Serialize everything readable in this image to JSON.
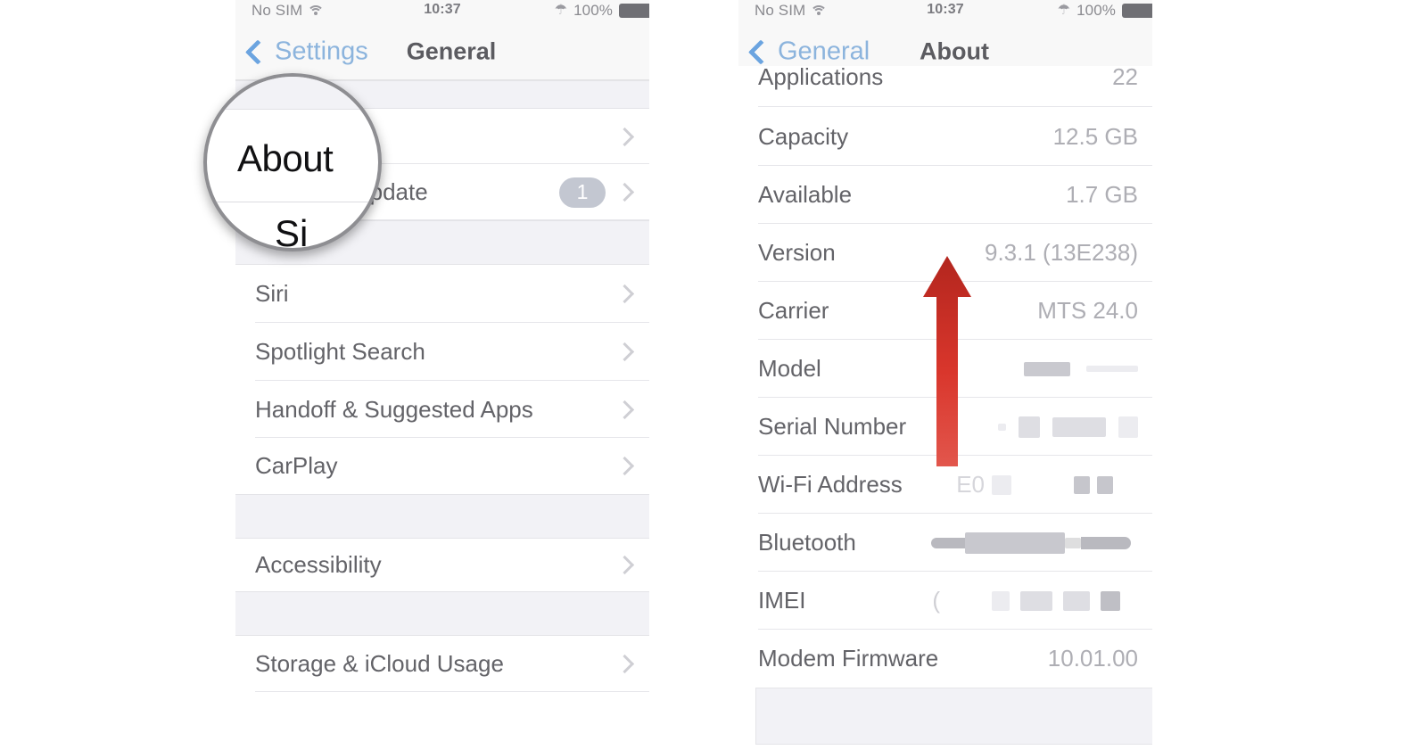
{
  "status_bar": {
    "carrier": "No SIM",
    "wifi_icon": "wifi-icon",
    "time": "10:37",
    "bluetooth_icon": "bluetooth-icon",
    "battery_percent": "100%",
    "battery_icon": "battery-full-icon"
  },
  "left_phone": {
    "nav": {
      "back_label": "Settings",
      "back_icon": "chevron-left-icon",
      "title": "General"
    },
    "rows": [
      {
        "label": "About",
        "value": "",
        "chevron": true,
        "badge": ""
      },
      {
        "label": "Software Update",
        "value": "",
        "chevron": true,
        "badge": "1"
      },
      {
        "label": "Siri",
        "value": "",
        "chevron": true,
        "badge": ""
      },
      {
        "label": "Spotlight Search",
        "value": "",
        "chevron": true,
        "badge": ""
      },
      {
        "label": "Handoff & Suggested Apps",
        "value": "",
        "chevron": true,
        "badge": ""
      },
      {
        "label": "CarPlay",
        "value": "",
        "chevron": true,
        "badge": ""
      },
      {
        "label": "Accessibility",
        "value": "",
        "chevron": true,
        "badge": ""
      },
      {
        "label": "Storage & iCloud Usage",
        "value": "",
        "chevron": true,
        "badge": ""
      }
    ]
  },
  "magnifier": {
    "zoomed_label": "About",
    "partial_label": "Si",
    "ring_color": "#8e8e92"
  },
  "right_phone": {
    "nav": {
      "back_label": "General",
      "back_icon": "chevron-left-icon",
      "title": "About"
    },
    "rows": [
      {
        "label": "Applications",
        "value": "22",
        "redacted": false
      },
      {
        "label": "Capacity",
        "value": "12.5 GB",
        "redacted": false
      },
      {
        "label": "Available",
        "value": "1.7 GB",
        "redacted": false
      },
      {
        "label": "Version",
        "value": "9.3.1 (13E238)",
        "redacted": false
      },
      {
        "label": "Carrier",
        "value": "MTS 24.0",
        "redacted": false
      },
      {
        "label": "Model",
        "value": "",
        "redacted": true
      },
      {
        "label": "Serial Number",
        "value": "",
        "redacted": true
      },
      {
        "label": "Wi-Fi Address",
        "value": "E0",
        "redacted": true
      },
      {
        "label": "Bluetooth",
        "value": "",
        "redacted": true
      },
      {
        "label": "IMEI",
        "value": "(",
        "redacted": true
      },
      {
        "label": "Modem Firmware",
        "value": "10.01.00",
        "redacted": false
      }
    ]
  },
  "annotation": {
    "arrow_name": "red-up-arrow",
    "arrow_color": "#d0342c",
    "arrow_direction": "up"
  }
}
